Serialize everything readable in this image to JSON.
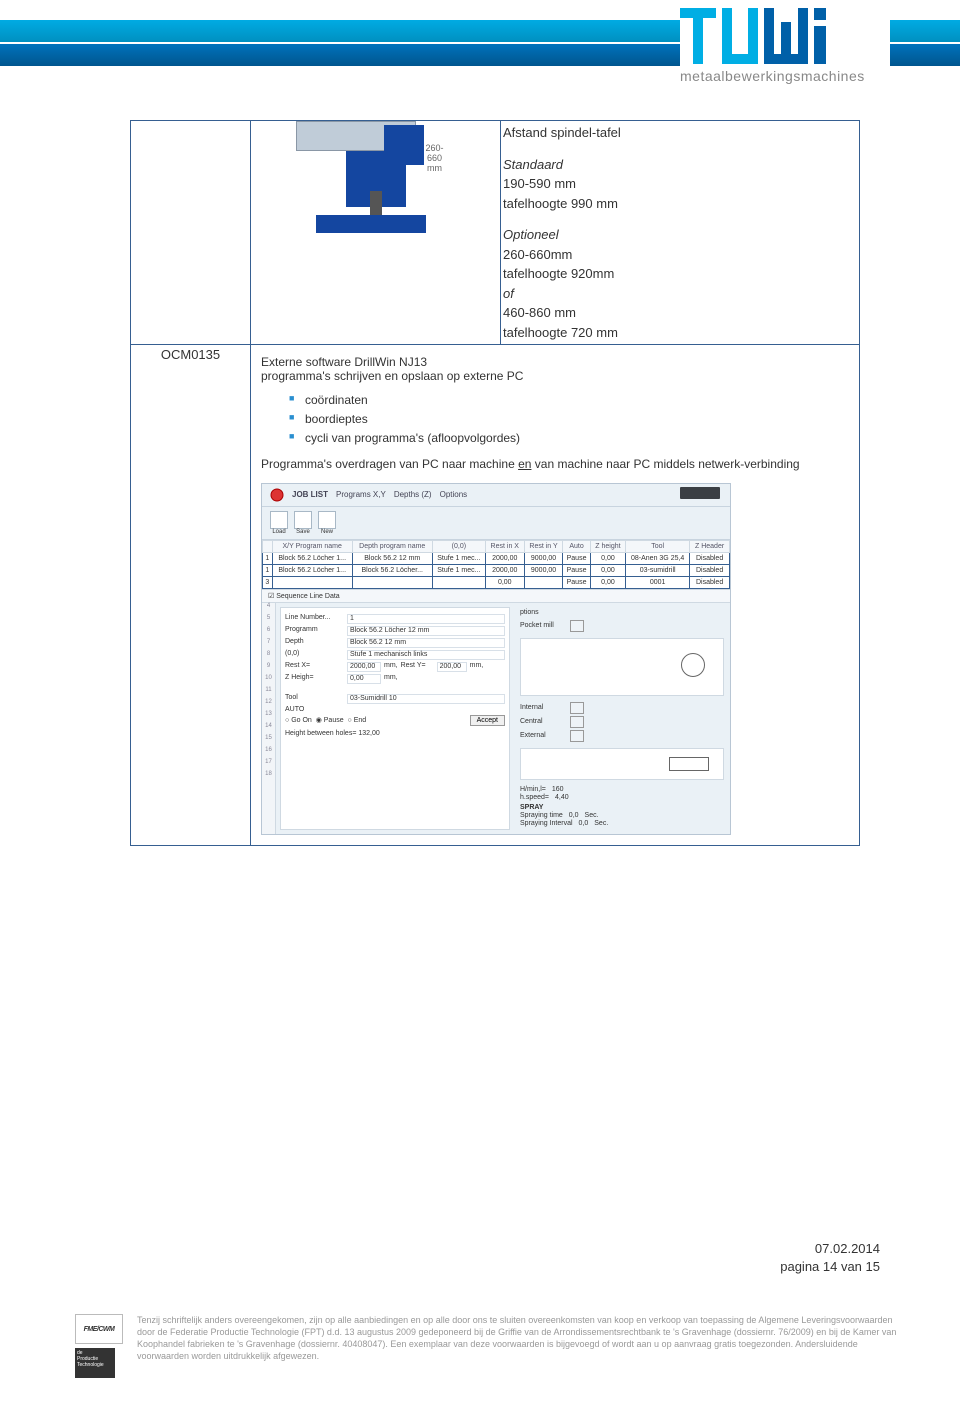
{
  "logo": {
    "tagline": "metaalbewerkingsmachines"
  },
  "row1": {
    "dim_label": "260-660 mm",
    "title": "Afstand spindel-tafel",
    "std_h": "Standaard",
    "std_1": "190-590 mm",
    "std_2": "tafelhoogte 990 mm",
    "opt_h": "Optioneel",
    "opt_1": "260-660mm",
    "opt_2": "tafelhoogte 920mm",
    "opt_of": "of",
    "opt_3": "460-860 mm",
    "opt_4": "tafelhoogte 720 mm"
  },
  "row2": {
    "code": "OCM0135",
    "line1": "Externe software DrillWin NJ13",
    "line2": "programma's schrijven en opslaan op externe PC",
    "bullets": [
      "coördinaten",
      "boordieptes",
      "cycli van programma's (afloopvolgordes)"
    ],
    "line3_a": "Programma's overdragen van PC naar machine ",
    "line3_u": "en",
    "line3_b": " van machine naar PC middels netwerk-verbinding"
  },
  "drillwin": {
    "tabs": [
      "JOB LIST",
      "Programs X,Y",
      "Depths (Z)",
      "Options"
    ],
    "icon_labels": [
      "Load",
      "Save",
      "New"
    ],
    "headers": [
      "",
      "X/Y Program name",
      "Depth program name",
      "(0,0)",
      "Rest in X",
      "Rest in Y",
      "Auto",
      "Z height",
      "Tool",
      "Z Header"
    ],
    "rows": [
      [
        "1",
        "Block 56.2 Löcher 1...",
        "Block 56.2 12 mm",
        "Stufe 1 mec...",
        "2000,00",
        "9000,00",
        "Pause",
        "0,00",
        "08-Anen 3G 25,4",
        "Disabled"
      ],
      [
        "1",
        "Block 56.2 Löcher 1...",
        "Block 56.2 Löcher...",
        "Stufe 1 mec...",
        "2000,00",
        "9000,00",
        "Pause",
        "0,00",
        "03-sumidrill",
        "Disabled"
      ],
      [
        "3",
        "",
        "",
        "",
        "0,00",
        "",
        "Pause",
        "0,00",
        "0001",
        "Disabled"
      ]
    ],
    "seq_title": "Sequence Line Data",
    "form": {
      "line_no_l": "Line Number...",
      "line_no_v": "1",
      "prog_l": "Programm",
      "prog_v": "Block 56.2 Löcher 12 mm",
      "depth_l": "Depth",
      "depth_v": "Block 56.2 12 mm",
      "oo_l": "(0,0)",
      "oo_v": "Stufe 1 mechanisch links",
      "rx_l": "Rest X=",
      "rx_v": "2000,00",
      "mm1": "mm,",
      "ry_l": "Rest Y=",
      "ry_v": "200,00",
      "mm2": "mm,",
      "zh_l": "Z Heigh=",
      "zh_v": "0,00",
      "mm3": "mm,",
      "tool_l": "Tool",
      "tool_v": "03-Sumidrill 10",
      "auto": "AUTO",
      "goon": "Go On",
      "pause": "Pause",
      "end": "End",
      "accept": "Accept",
      "hb": "Height between holes=",
      "hb_v": "132,00"
    },
    "right": {
      "opt_h": "ptions",
      "pocket": "Pocket mill",
      "internal": "Internal",
      "central": "Central",
      "external": "External",
      "hl": "H/min,l=",
      "hl_v": "160",
      "sp": "h.speed=",
      "sp_v": "4,40",
      "spray_h": "SPRAY",
      "st": "Spraying time",
      "st_v": "0,0",
      "sec1": "Sec.",
      "si": "Spraying Interval",
      "si_v": "0,0",
      "sec2": "Sec."
    }
  },
  "footer": {
    "date": "07.02.2014",
    "page": "pagina 14 van 15",
    "fme": "FME/CWM",
    "pt1": "de",
    "pt2": "Productie",
    "pt3": "Technologie",
    "disclaimer": "Tenzij schriftelijk anders overeengekomen, zijn op alle aanbiedingen en op alle door ons te sluiten overeenkomsten van koop en verkoop van toepassing de Algemene Leveringsvoorwaarden door de Federatie Productie Technologie (FPT) d.d. 13 augustus 2009 gedeponeerd bij de Griffie van de Arrondissementsrechtbank te 's Gravenhage (dossiernr. 76/2009) en bij de Kamer van Koophandel fabrieken te 's Gravenhage (dossiernr. 40408047). Een exemplaar van deze voorwaarden is bijgevoegd of wordt aan u op aanvraag gratis toegezonden. Andersluidende voorwaarden worden uitdrukkelijk afgewezen."
  }
}
